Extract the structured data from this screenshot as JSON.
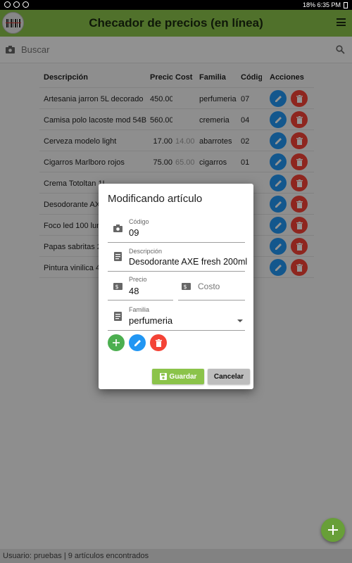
{
  "status": {
    "right_text": "18% 6:35 PM"
  },
  "appbar": {
    "title": "Checador de precios (en línea)"
  },
  "search": {
    "placeholder": "Buscar"
  },
  "table": {
    "headers": {
      "desc": "Descripción",
      "precio": "Precio",
      "cost": "Cost",
      "familia": "Familia",
      "codigo": "Código",
      "acciones": "Acciones"
    },
    "rows": [
      {
        "desc": "Artesania jarron 5L decorado",
        "precio": "450.00",
        "cost": "",
        "familia": "perfumeria",
        "codigo": "07"
      },
      {
        "desc": "Camisa polo lacoste mod 54B",
        "precio": "560.00",
        "cost": "",
        "familia": "cremeria",
        "codigo": "04"
      },
      {
        "desc": "Cerveza modelo light",
        "precio": "17.00",
        "cost": "14.00",
        "familia": "abarrotes",
        "codigo": "02"
      },
      {
        "desc": "Cigarros Marlboro rojos",
        "precio": "75.00",
        "cost": "65.00",
        "familia": "cigarros",
        "codigo": "01"
      },
      {
        "desc": "Crema Totoltan 1L",
        "precio": "",
        "cost": "",
        "familia": "",
        "codigo": ""
      },
      {
        "desc": "Desodorante AX",
        "precio": "",
        "cost": "",
        "familia": "",
        "codigo": ""
      },
      {
        "desc": "Foco led 100 lum",
        "precio": "",
        "cost": "",
        "familia": "",
        "codigo": ""
      },
      {
        "desc": "Papas sabritas 2",
        "precio": "",
        "cost": "",
        "familia": "",
        "codigo": ""
      },
      {
        "desc": "Pintura vinilica 4",
        "precio": "",
        "cost": "",
        "familia": "",
        "codigo": ""
      }
    ]
  },
  "dialog": {
    "title": "Modificando artículo",
    "codigo_label": "Código",
    "codigo_value": "09",
    "desc_label": "Descripción",
    "desc_value": "Desodorante AXE fresh 200ml",
    "precio_label": "Precio",
    "precio_value": "48",
    "costo_placeholder": "Costo",
    "familia_label": "Familia",
    "familia_value": "perfumeria",
    "save_label": "Guardar",
    "cancel_label": "Cancelar"
  },
  "footer": {
    "text": "Usuario: pruebas  |  9 artículos encontrados"
  },
  "colors": {
    "primary": "#8bc34a",
    "edit": "#2196f3",
    "delete": "#f44336",
    "add": "#4caf50"
  },
  "icons": [
    "camera-icon",
    "search-icon",
    "menu-icon",
    "pencil-icon",
    "trash-icon",
    "plus-icon",
    "document-icon",
    "price-tag-icon",
    "dropdown-icon",
    "save-icon"
  ]
}
